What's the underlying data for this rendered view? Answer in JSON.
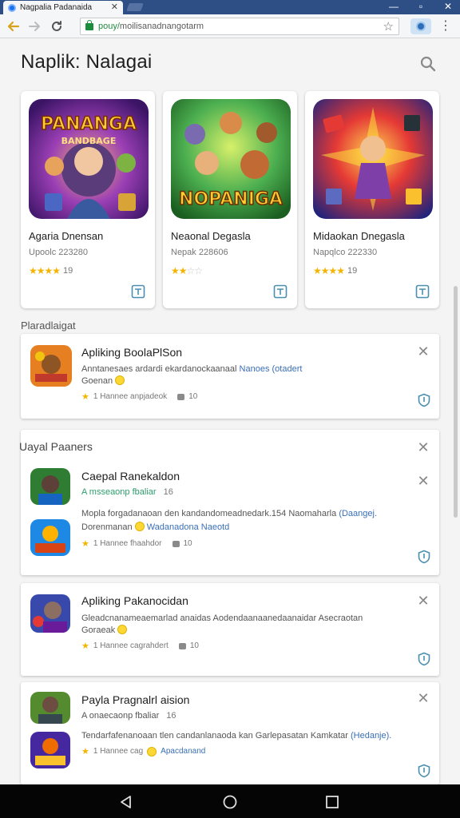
{
  "browser": {
    "tab_title": "Nagpalia Padanaida",
    "url_scheme": "pouy/",
    "url_rest": "moilisanadnangotarm",
    "accent": "#2d4f86"
  },
  "page": {
    "title": "Naplik: Nalagai",
    "featured": [
      {
        "name": "Agaria Dnensan",
        "developer": "Upoolc 223280",
        "stars": 4,
        "rating_count": "19",
        "art_text": "PANANGA",
        "art_sub": "BANDBAGE"
      },
      {
        "name": "Neaonal Degasla",
        "developer": "Nepak 228606",
        "stars": 2,
        "rating_count": "",
        "art_text": "NOPANIGA",
        "art_sub": ""
      },
      {
        "name": "Midaokan Dnegasla",
        "developer": "Napqlco 222330",
        "stars": 4,
        "rating_count": "19",
        "art_text": "",
        "art_sub": ""
      }
    ],
    "section_label": "Plaradlaigat",
    "list1": {
      "title": "Apliking BoolaPlSon",
      "desc_text": "Anntanesaes ardardi ekardanockaanaal",
      "desc_link": "Nanoes (otadert",
      "desc_line2": "Goenan",
      "meta_rating": "1 Hannee anpjadeok",
      "meta_count": "10"
    },
    "group": {
      "header": "Uayal Paaners",
      "item1_title": "Caepal Ranekaldon",
      "item1_sub": "A msseaonp fbaliar",
      "item1_sub_badge": "16",
      "desc_text": "Mopla forgadanaoan den kandandomeadnedark.154 Naomaharla",
      "desc_link": "(Daangej.",
      "desc_line2": "Dorenmanan",
      "desc_line2_link": "Wadanadona Naeotd",
      "meta_rating": "1 Hannee fhaahdor",
      "meta_count": "10"
    },
    "list2": {
      "title": "Apliking Pakanocidan",
      "desc_text": "Gleadcnanameaemarlad anaidas Aodendaanaanedaanaidar Asecraotan",
      "desc_line2": "Goraeak",
      "meta_rating": "1 Hannee cagrahdert",
      "meta_count": "10"
    },
    "list3": {
      "title": "Payla Pragnalrl aision",
      "sub": "A onaecaonp fbaliar",
      "sub_badge": "16",
      "desc_text": "Tendarfafenanoaan tlen candanlanaoda kan Garlepasatan Kamkatar",
      "desc_link": "(Hedanje).",
      "meta_rating": "1 Hannee cag",
      "meta_link": "Apacdanand"
    }
  }
}
